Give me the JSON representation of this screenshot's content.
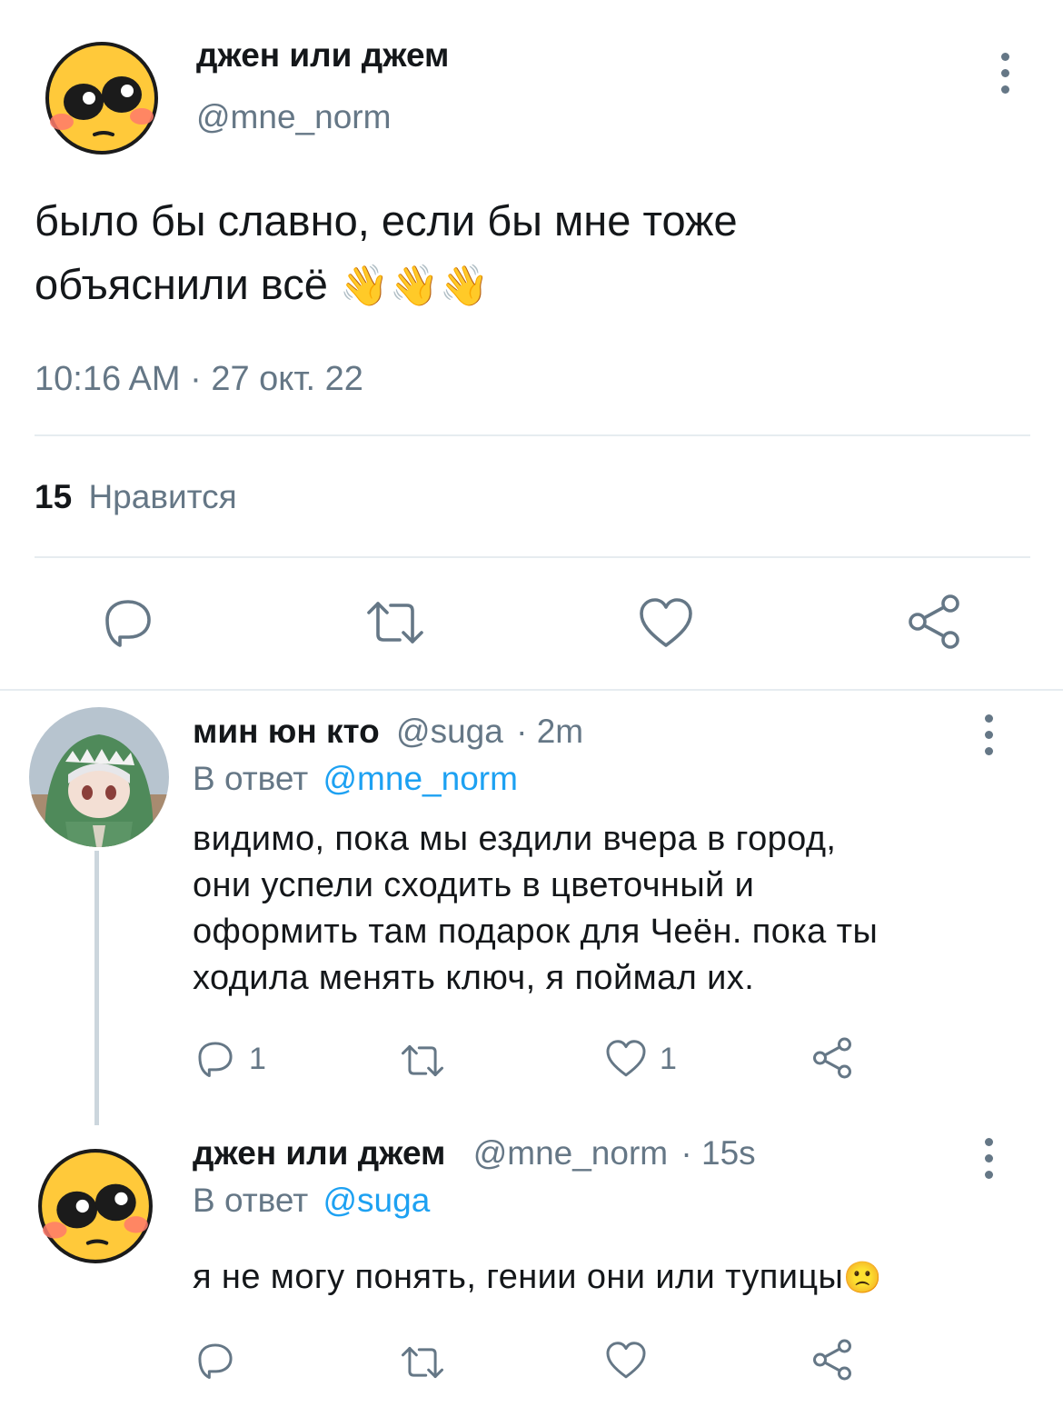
{
  "main_tweet": {
    "display_name": "джен или джем",
    "handle": "@mne_norm",
    "text_line1": "было бы славно, если бы мне тоже",
    "text_line2": "объяснили всё",
    "emoji": "👋👋👋",
    "timestamp": "10:16 AM · 27 окт. 22",
    "likes_count": "15",
    "likes_label": "Нравится"
  },
  "replies": [
    {
      "display_name": "мин юн кто",
      "handle": "@suga",
      "time": "· 2m",
      "reply_prefix": "В ответ",
      "reply_to": "@mne_norm",
      "lines": [
        "видимо, пока мы ездили вчера в город,",
        "они успели сходить в цветочный и",
        "оформить там подарок для Чеён. пока ты",
        "ходила менять ключ, я поймал их."
      ],
      "reply_count": "1",
      "like_count": "1"
    },
    {
      "display_name": "джен или джем",
      "handle": "@mne_norm",
      "time": "· 15s",
      "reply_prefix": "В ответ",
      "reply_to": "@suga",
      "text": "я не могу понять, гении они или тупицы",
      "emoji": "🙁"
    }
  ],
  "colors": {
    "text": "#14171a",
    "secondary": "#657786",
    "link": "#1da1f2",
    "divider": "#e6ecf0"
  }
}
